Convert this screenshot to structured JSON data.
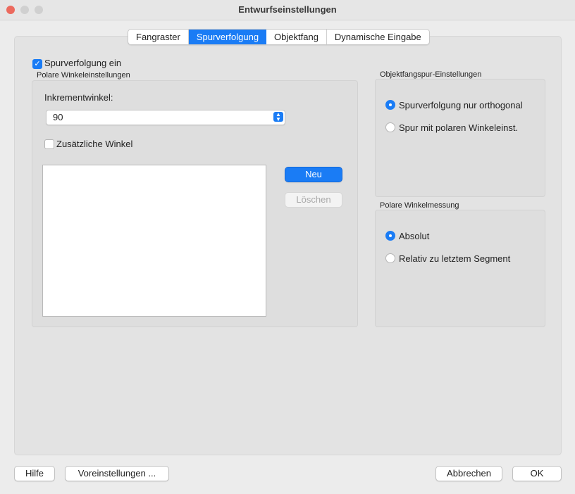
{
  "window": {
    "title": "Entwurfseinstellungen"
  },
  "tabs": [
    {
      "label": "Fangraster",
      "active": false
    },
    {
      "label": "Spurverfolgung",
      "active": true
    },
    {
      "label": "Objektfang",
      "active": false
    },
    {
      "label": "Dynamische Eingabe",
      "active": false
    }
  ],
  "tracking": {
    "enable_label": "Spurverfolgung ein",
    "enabled": true
  },
  "polar": {
    "group_title": "Polare Winkeleinstellungen",
    "increment_label": "Inkrementwinkel:",
    "increment_value": "90",
    "additional_label": "Zusätzliche Winkel",
    "additional_checked": false,
    "new_button": "Neu",
    "delete_button": "Löschen"
  },
  "snap_tracking": {
    "group_title": "Objektfangspur-Einstellungen",
    "options": [
      {
        "label": "Spurverfolgung nur orthogonal",
        "selected": true
      },
      {
        "label": "Spur mit polaren Winkeleinst.",
        "selected": false
      }
    ]
  },
  "polar_measure": {
    "group_title": "Polare Winkelmessung",
    "options": [
      {
        "label": "Absolut",
        "selected": true
      },
      {
        "label": "Relativ zu letztem Segment",
        "selected": false
      }
    ]
  },
  "footer": {
    "help": "Hilfe",
    "defaults": "Voreinstellungen ...",
    "cancel": "Abbrechen",
    "ok": "OK"
  },
  "colors": {
    "accent": "#1a7cf5",
    "close": "#ec6a5e"
  }
}
